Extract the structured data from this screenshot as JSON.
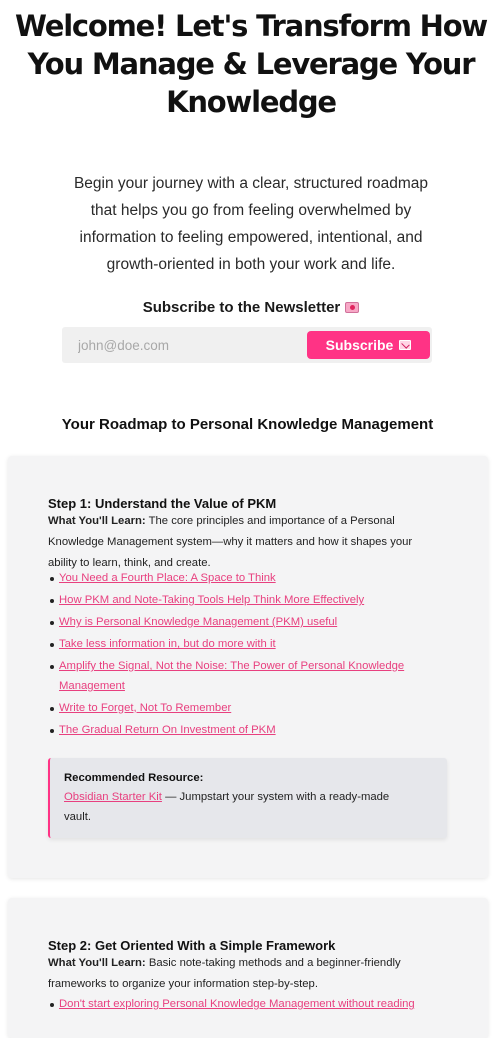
{
  "hero": {
    "title_lines": [
      "Welcome! Let's Transform How",
      "You Manage & Leverage Your",
      "Knowledge"
    ]
  },
  "intro": {
    "lines": [
      "Begin your journey with a clear, structured roadmap",
      "that helps you go from feeling overwhelmed by",
      "information to feeling empowered, intentional, and",
      "growth-oriented in both your work and life."
    ]
  },
  "newsletter": {
    "heading": "Subscribe to the Newsletter",
    "heading_icon": "love-letter-icon",
    "email_placeholder": "john@doe.com",
    "email_value": "",
    "button_label": "Subscribe",
    "button_icon": "envelope-icon"
  },
  "roadmap": {
    "heading": "Your Roadmap to Personal Knowledge Management",
    "steps": [
      {
        "title": "Step 1: Understand the Value of PKM",
        "learn_label": "What You'll Learn:",
        "desc_lines": [
          "The core principles and importance of a Personal",
          "Knowledge Management system—why it matters and how it shapes your",
          "ability to learn, think, and create."
        ],
        "links": [
          "You Need a Fourth Place: A Space to Think",
          "How PKM and Note-Taking Tools Help Think More Effectively",
          "Why is Personal Knowledge Management (PKM) useful",
          "Take less information in, but do more with it",
          "Amplify the Signal, Not the Noise: The Power of Personal Knowledge",
          "Management",
          "Write to Forget, Not To Remember",
          "The Gradual Return On Investment of PKM"
        ],
        "resource": {
          "heading": "Recommended Resource:",
          "link": "Obsidian Starter Kit",
          "text_1": " — Jumpstart your system with a ready-made",
          "text_2": "vault."
        }
      },
      {
        "title": "Step 2: Get Oriented With a Simple Framework",
        "learn_label": "What You'll Learn:",
        "desc_lines": [
          "Basic note-taking methods and a beginner-friendly",
          "frameworks to organize your information step-by-step."
        ],
        "links": [
          "Don't start exploring Personal Knowledge Management without reading"
        ]
      }
    ]
  },
  "colors": {
    "accent": "#ff3385",
    "link": "#e8407f",
    "card_bg": "#f4f4f5"
  }
}
